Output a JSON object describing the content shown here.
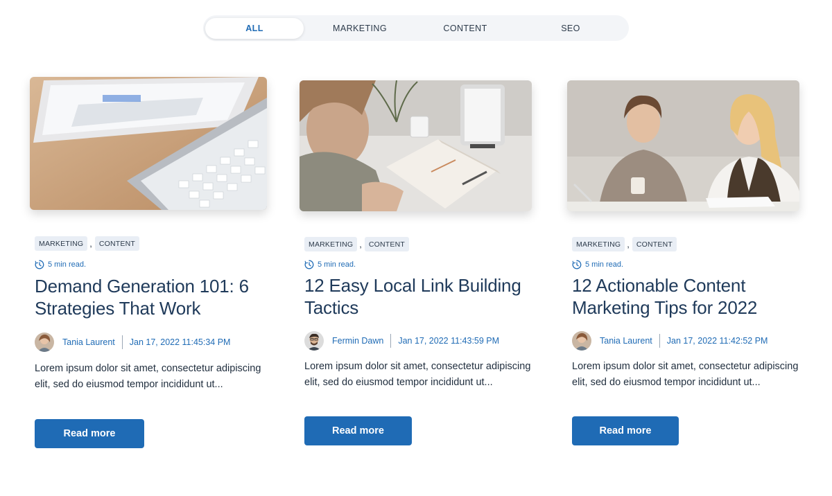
{
  "filters": {
    "tabs": [
      {
        "label": "ALL",
        "active": true
      },
      {
        "label": "MARKETING",
        "active": false
      },
      {
        "label": "CONTENT",
        "active": false
      },
      {
        "label": "SEO",
        "active": false
      }
    ]
  },
  "posts": [
    {
      "tags": [
        "MARKETING",
        "CONTENT"
      ],
      "read_time": "5 min read.",
      "title": "Demand Generation 101: 6 Strategies That Work",
      "author": "Tania Laurent",
      "date": "Jan 17, 2022 11:45:34 PM",
      "excerpt": "Lorem ipsum dolor sit amet, consectetur adipiscing elit, sed do eiusmod tempor incididunt ut...",
      "cta": "Read more",
      "image": "tablet-keyboard-photo"
    },
    {
      "tags": [
        "MARKETING",
        "CONTENT"
      ],
      "read_time": "5 min read.",
      "title": "12 Easy Local Link Building Tactics",
      "author": "Fermin Dawn",
      "date": "Jan 17, 2022 11:43:59 PM",
      "excerpt": "Lorem ipsum dolor sit amet, consectetur adipiscing elit, sed do eiusmod tempor incididunt ut...",
      "cta": "Read more",
      "image": "desk-notebook-photo"
    },
    {
      "tags": [
        "MARKETING",
        "CONTENT"
      ],
      "read_time": "5 min read.",
      "title": "12 Actionable Content Marketing Tips for 2022",
      "author": "Tania Laurent",
      "date": "Jan 17, 2022 11:42:52 PM",
      "excerpt": "Lorem ipsum dolor sit amet, consectetur adipiscing elit, sed do eiusmod tempor incididunt ut...",
      "cta": "Read more",
      "image": "two-women-meeting-photo"
    }
  ],
  "colors": {
    "accent": "#1f6bb5",
    "tag_bg": "#e9eef5",
    "title": "#1f3a5a",
    "tabs_bg": "#f3f5f8"
  }
}
